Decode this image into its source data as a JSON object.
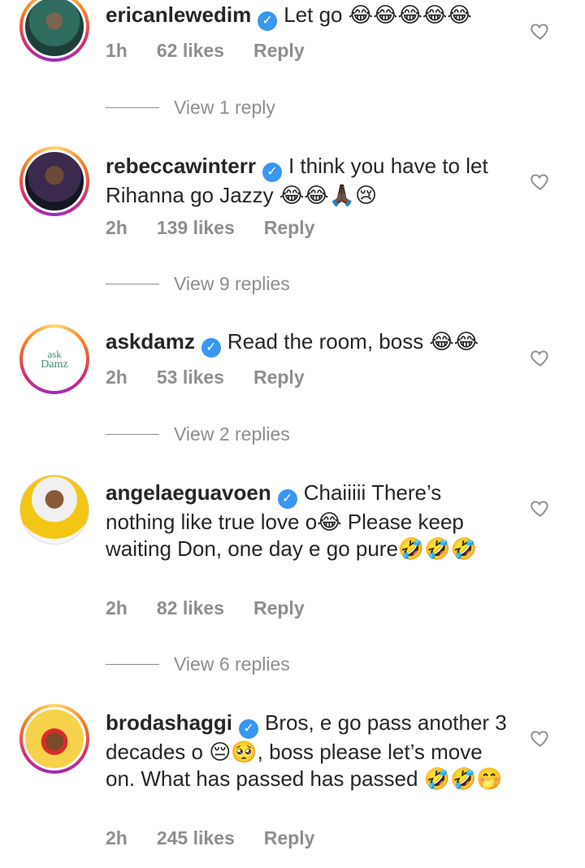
{
  "comments": [
    {
      "username": "ericanlewedim",
      "text": "Let go 😂😂😂😂😂",
      "time": "1h",
      "likes": "62 likes",
      "reply": "Reply",
      "view_replies": "View 1 reply"
    },
    {
      "username": "rebeccawinterr",
      "text": "I think you have to let Rihanna go Jazzy 😂😂🙏🏿😢",
      "time": "2h",
      "likes": "139 likes",
      "reply": "Reply",
      "view_replies": "View 9 replies"
    },
    {
      "username": "askdamz",
      "text": "Read the room, boss 😂😂",
      "time": "2h",
      "likes": "53 likes",
      "reply": "Reply",
      "view_replies": "View 2 replies",
      "avatar_text": [
        "ask",
        "Damz"
      ]
    },
    {
      "username": "angelaeguavoen",
      "text": "Chaiiiii There’s nothing like true love o😂 Please keep waiting Don, one day e go pure🤣🤣🤣",
      "time": "2h",
      "likes": "82 likes",
      "reply": "Reply",
      "view_replies": "View 6 replies"
    },
    {
      "username": "brodashaggi",
      "text": "Bros, e go pass another 3 decades o 😔🥺, boss please let’s move on. What has passed has passed 🤣🤣🤭",
      "time": "2h",
      "likes": "245 likes",
      "reply": "Reply"
    }
  ],
  "icons": {
    "verified": "verified-badge-icon",
    "like": "heart-icon"
  },
  "colors": {
    "verified": "#3897f0",
    "meta_text": "#8e8e8e",
    "text": "#262626"
  }
}
